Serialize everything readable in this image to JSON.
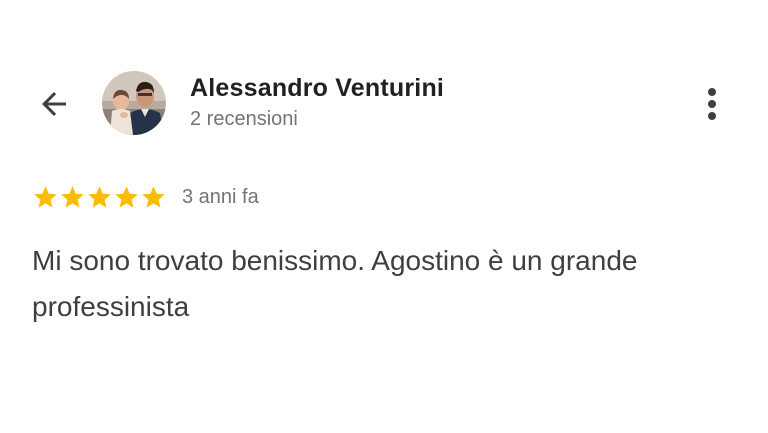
{
  "reviewer": {
    "name": "Alessandro Venturini",
    "review_count": "2 recensioni",
    "avatar_icon": "profile-photo"
  },
  "header": {
    "back_icon": "arrow-left-icon",
    "menu_icon": "more-vert-icon"
  },
  "review": {
    "rating": 5,
    "rating_max": 5,
    "time_ago": "3 anni fa",
    "text": "Mi sono trovato benissimo. Agostino è un grande professinista"
  },
  "colors": {
    "star": "#fbbc04",
    "secondary_text": "#70757a",
    "body_text": "#3c4043",
    "name_text": "#202124"
  }
}
